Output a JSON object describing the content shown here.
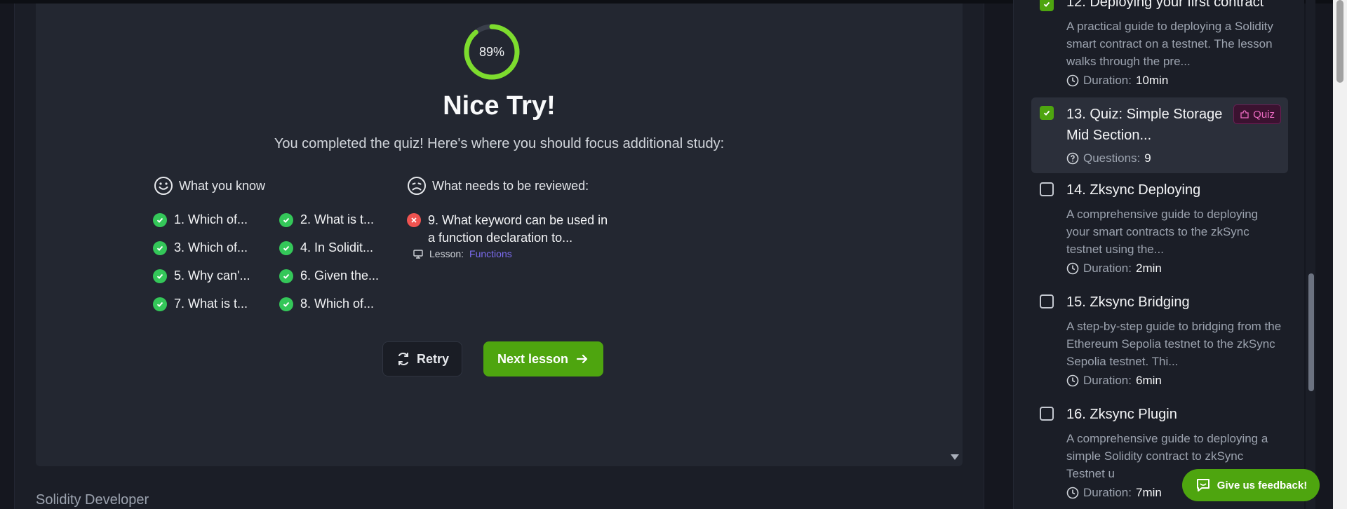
{
  "quiz": {
    "score_text": "89%",
    "score_fraction": 0.89,
    "title": "Nice Try!",
    "subtitle": "You completed the quiz! Here's where you should focus additional study:",
    "know_heading": "What you know",
    "review_heading": "What needs to be reviewed:",
    "known_items": [
      "1. Which of...",
      "2. What is t...",
      "3. Which of...",
      "4. In Solidit...",
      "5. Why can'...",
      "6. Given the...",
      "7. What is t...",
      "8. Which of..."
    ],
    "review_item": {
      "text": "9. What keyword can be used in a function declaration to...",
      "lesson_prefix": "Lesson:",
      "lesson_link": "Functions"
    },
    "retry_label": "Retry",
    "next_label": "Next lesson"
  },
  "footer": {
    "course_name": "Solidity Developer"
  },
  "sidebar": {
    "lessons": [
      {
        "title": "12. Deploying your first contract",
        "desc": "A practical guide to deploying a Solidity smart contract on a testnet. The lesson walks through the pre...",
        "meta_label": "Duration:",
        "meta_value": "10min",
        "checked": true
      },
      {
        "title": "13. Quiz: Simple Storage Mid Section...",
        "badge": "Quiz",
        "meta_label": "Questions:",
        "meta_value": "9",
        "checked": true
      },
      {
        "title": "14. Zksync Deploying",
        "desc": "A comprehensive guide to deploying your smart contracts to the zkSync testnet using the...",
        "meta_label": "Duration:",
        "meta_value": "2min",
        "checked": false
      },
      {
        "title": "15. Zksync Bridging",
        "desc": "A step-by-step guide to bridging from the Ethereum Sepolia testnet to the zkSync Sepolia testnet. Thi...",
        "meta_label": "Duration:",
        "meta_value": "6min",
        "checked": false
      },
      {
        "title": "16. Zksync Plugin",
        "desc": "A comprehensive guide to deploying a simple Solidity contract to zkSync Testnet u",
        "meta_label": "Duration:",
        "meta_value": "7min",
        "checked": false
      }
    ]
  },
  "feedback_label": "Give us feedback!",
  "colors": {
    "accent": "#4ea50f",
    "success": "#34c759",
    "error": "#ef5350",
    "link": "#7c6cf0",
    "quiz_badge": "#ec6bc2"
  }
}
